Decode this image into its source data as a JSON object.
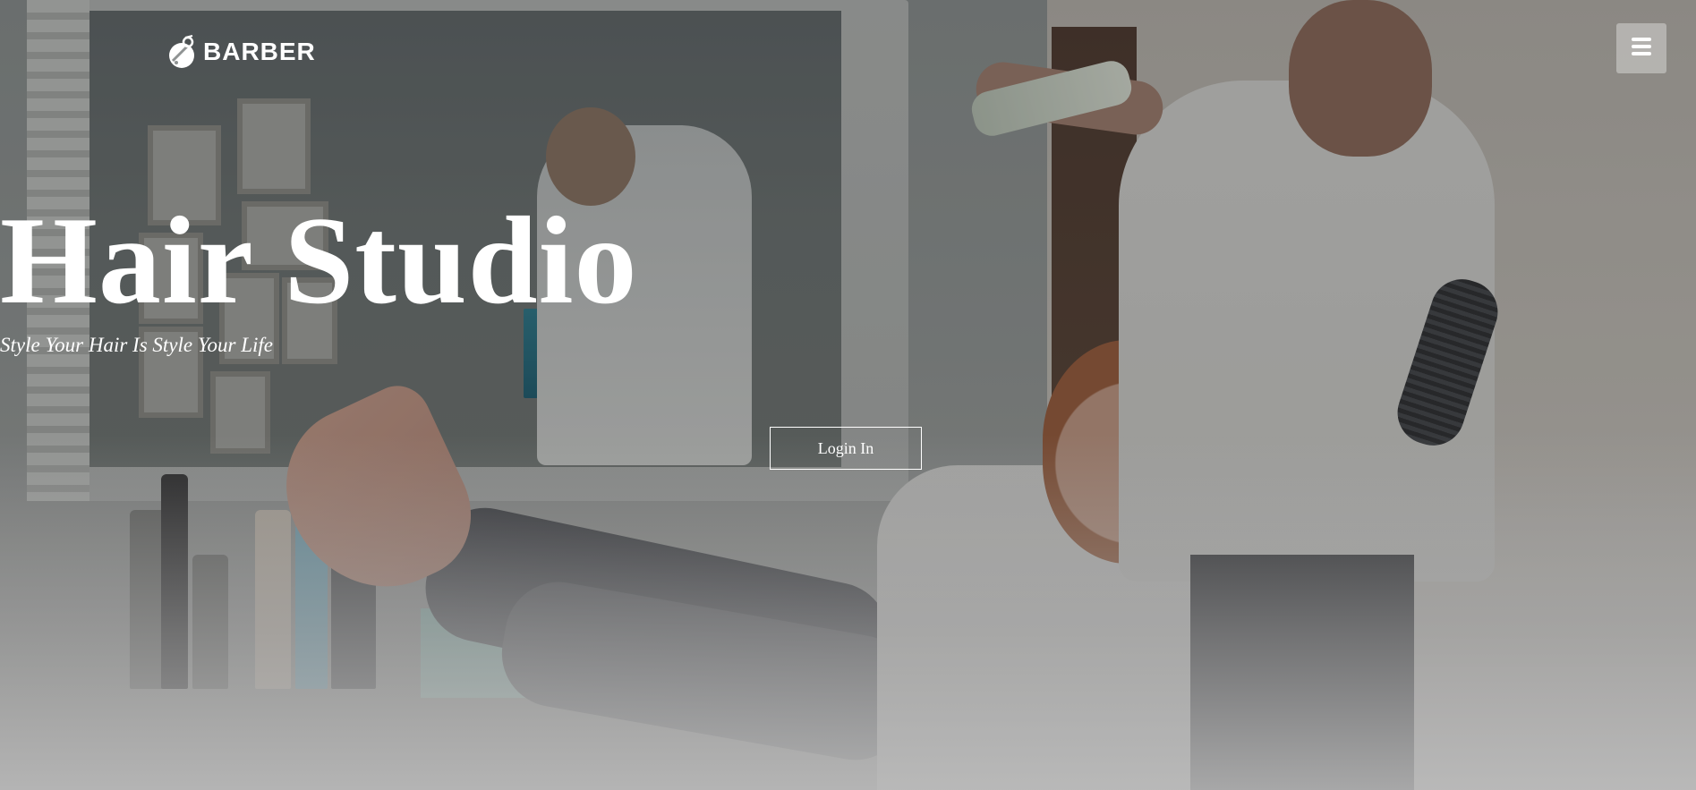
{
  "header": {
    "logo_text": "BARBER",
    "logo_icon": "barber-logo-icon",
    "menu_icon": "hamburger-menu-icon"
  },
  "hero": {
    "title": "Hair Studio",
    "subtitle": "Style Your Hair Is Style Your Life",
    "cta_label": "Login In"
  },
  "colors": {
    "text": "#ffffff",
    "menu_button_bg": "#b3b3b3",
    "overlay": "#141414"
  }
}
